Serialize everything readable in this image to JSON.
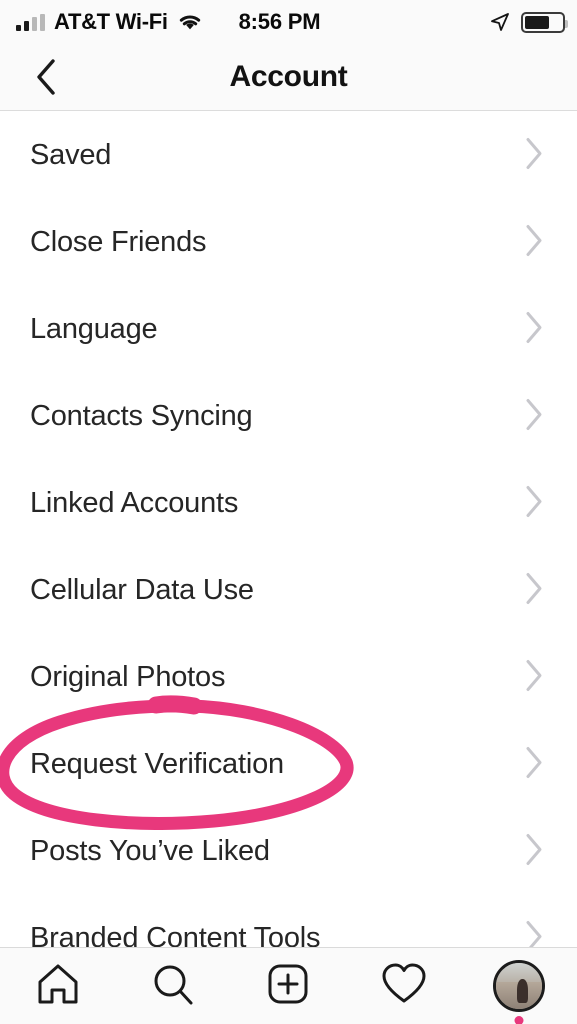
{
  "status_bar": {
    "carrier": "AT&T Wi-Fi",
    "time": "8:56 PM",
    "signal_bars_total": 4,
    "signal_bars_filled": 2,
    "wifi_icon": "wifi-icon",
    "location_icon": "location-arrow-icon",
    "battery_icon": "battery-icon",
    "battery_level_percent": 62
  },
  "header": {
    "title": "Account",
    "back_icon": "chevron-left-icon"
  },
  "list": {
    "chevron_icon": "chevron-right-icon",
    "items": [
      {
        "label": "Saved"
      },
      {
        "label": "Close Friends"
      },
      {
        "label": "Language"
      },
      {
        "label": "Contacts Syncing"
      },
      {
        "label": "Linked Accounts"
      },
      {
        "label": "Cellular Data Use"
      },
      {
        "label": "Original Photos"
      },
      {
        "label": "Request Verification"
      },
      {
        "label": "Posts You’ve Liked"
      },
      {
        "label": "Branded Content Tools"
      }
    ]
  },
  "annotation": {
    "type": "hand-drawn-ellipse",
    "target_label": "Request Verification",
    "color": "#e8387c",
    "stroke_width": 13
  },
  "tab_bar": {
    "items": [
      {
        "name": "home",
        "icon": "home-icon"
      },
      {
        "name": "search",
        "icon": "search-icon"
      },
      {
        "name": "create",
        "icon": "plus-square-icon"
      },
      {
        "name": "activity",
        "icon": "heart-icon"
      },
      {
        "name": "profile",
        "icon": "avatar-icon"
      }
    ],
    "profile_badge_color": "#e8387c"
  },
  "colors": {
    "accent_pink": "#e8387c",
    "text_primary": "#262626",
    "chevron_gray": "#c7c7cc",
    "bar_background": "#fafafa"
  }
}
